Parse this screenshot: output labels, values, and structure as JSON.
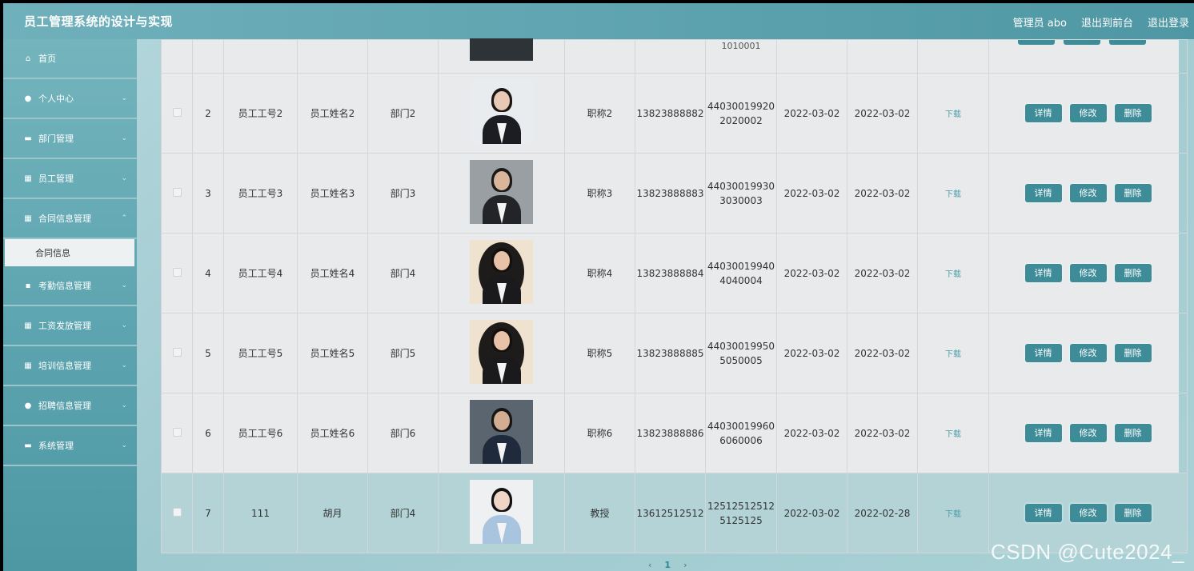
{
  "header": {
    "title": "员工管理系统的设计与实现",
    "admin": "管理员 abo",
    "to_front": "退出到前台",
    "logout": "退出登录"
  },
  "sidebar": {
    "items": [
      {
        "label": "首页",
        "icon": "home-icon"
      },
      {
        "label": "个人中心",
        "icon": "user-icon"
      },
      {
        "label": "部门管理",
        "icon": "briefcase-icon"
      },
      {
        "label": "员工管理",
        "icon": "grid-icon"
      },
      {
        "label": "合同信息管理",
        "icon": "grid-icon"
      },
      {
        "label": "考勤信息管理",
        "icon": "comment-icon"
      },
      {
        "label": "工资发放管理",
        "icon": "grid-icon"
      },
      {
        "label": "培训信息管理",
        "icon": "grid-icon"
      },
      {
        "label": "招聘信息管理",
        "icon": "bulb-icon"
      },
      {
        "label": "系统管理",
        "icon": "monitor-icon"
      }
    ],
    "sub_item": "合同信息"
  },
  "table": {
    "partial_row": {
      "id_tail": "1010001"
    },
    "rows": [
      {
        "no": "2",
        "emp_no": "员工工号2",
        "name": "员工姓名2",
        "dept": "部门2",
        "title": "职称2",
        "phone": "13823888882",
        "id1": "44030019920",
        "id2": "2020002",
        "date1": "2022-03-02",
        "date2": "2022-03-02",
        "download": "下载"
      },
      {
        "no": "3",
        "emp_no": "员工工号3",
        "name": "员工姓名3",
        "dept": "部门3",
        "title": "职称3",
        "phone": "13823888883",
        "id1": "44030019930",
        "id2": "3030003",
        "date1": "2022-03-02",
        "date2": "2022-03-02",
        "download": "下载"
      },
      {
        "no": "4",
        "emp_no": "员工工号4",
        "name": "员工姓名4",
        "dept": "部门4",
        "title": "职称4",
        "phone": "13823888884",
        "id1": "44030019940",
        "id2": "4040004",
        "date1": "2022-03-02",
        "date2": "2022-03-02",
        "download": "下载"
      },
      {
        "no": "5",
        "emp_no": "员工工号5",
        "name": "员工姓名5",
        "dept": "部门5",
        "title": "职称5",
        "phone": "13823888885",
        "id1": "44030019950",
        "id2": "5050005",
        "date1": "2022-03-02",
        "date2": "2022-03-02",
        "download": "下载"
      },
      {
        "no": "6",
        "emp_no": "员工工号6",
        "name": "员工姓名6",
        "dept": "部门6",
        "title": "职称6",
        "phone": "13823888886",
        "id1": "44030019960",
        "id2": "6060006",
        "date1": "2022-03-02",
        "date2": "2022-03-02",
        "download": "下载"
      },
      {
        "no": "7",
        "emp_no": "111",
        "name": "胡月",
        "dept": "部门4",
        "title": "教授",
        "phone": "13612512512",
        "id1": "12512512512",
        "id2": "5125125",
        "date1": "2022-03-02",
        "date2": "2022-02-28",
        "download": "下载"
      }
    ],
    "actions": {
      "detail": "详情",
      "edit": "修改",
      "delete": "删除"
    }
  },
  "pager": {
    "prev": "‹",
    "current": "1",
    "next": "›"
  },
  "watermark": "CSDN @Cute2024_"
}
